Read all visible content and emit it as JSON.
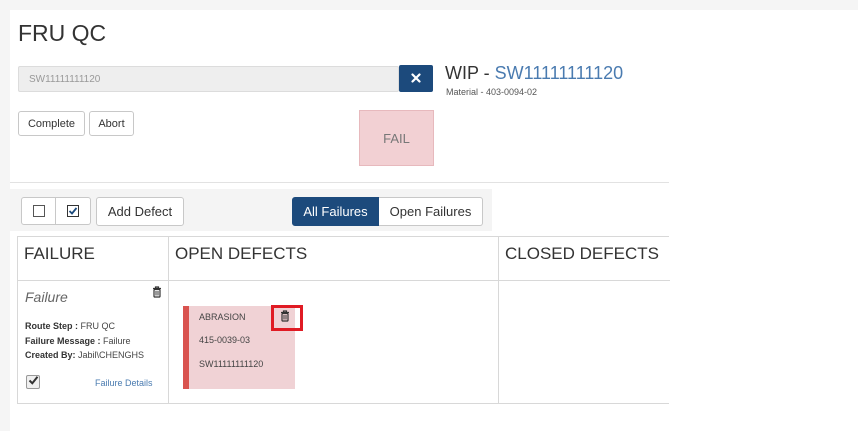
{
  "page": {
    "title": "FRU QC"
  },
  "search": {
    "value": "SW11111111120"
  },
  "wip": {
    "prefix": "WIP - ",
    "serial": "SW11111111120",
    "material": "Material - 403-0094-02",
    "status": "FAIL"
  },
  "actions": {
    "complete_label": "Complete",
    "abort_label": "Abort"
  },
  "toolbar": {
    "add_defect_label": "Add Defect",
    "filters": [
      {
        "label": "All Failures",
        "active": true
      },
      {
        "label": "Open Failures",
        "active": false
      }
    ]
  },
  "columns": {
    "failure": "FAILURE",
    "open_defects": "OPEN DEFECTS",
    "closed_defects": "CLOSED DEFECTS"
  },
  "failure": {
    "title": "Failure",
    "route_step_label": "Route Step :",
    "route_step_value": "FRU QC",
    "message_label": "Failure Message :",
    "message_value": "Failure",
    "created_label": "Created By:",
    "created_value": "Jabil\\CHENGHS",
    "details_link": "Failure Details",
    "checked": true
  },
  "open_defects": [
    {
      "type": "ABRASION",
      "part": "415-0039-03",
      "serial": "SW11111111120"
    }
  ],
  "icons": {
    "clear": "close-icon",
    "delete": "trash-icon",
    "check": "checkmark-icon"
  },
  "colors": {
    "primary": "#1c4a7c",
    "link": "#4a7bb0",
    "fail_bg": "#f2d0d3",
    "defect_accent": "#d9534f",
    "highlight": "#e01b24"
  }
}
